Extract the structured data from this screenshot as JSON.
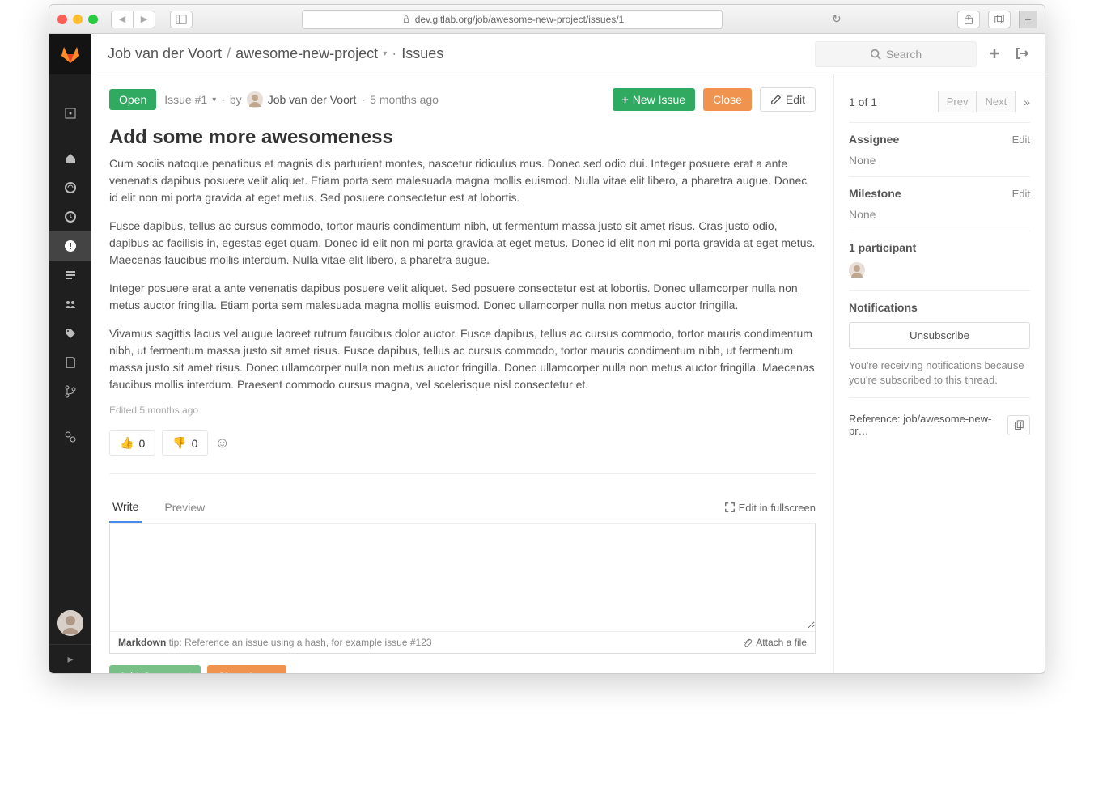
{
  "browser": {
    "url": "dev.gitlab.org/job/awesome-new-project/issues/1"
  },
  "breadcrumb": {
    "owner": "Job van der Voort",
    "project": "awesome-new-project",
    "section": "Issues"
  },
  "search": {
    "placeholder": "Search"
  },
  "issue": {
    "state": "Open",
    "ref": "Issue #1",
    "by": "by",
    "author": "Job van der Voort",
    "time": "5 months ago",
    "title": "Add some more awesomeness",
    "paragraphs": {
      "p1": "Cum sociis natoque penatibus et magnis dis parturient montes, nascetur ridiculus mus. Donec sed odio dui. Integer posuere erat a ante venenatis dapibus posuere velit aliquet. Etiam porta sem malesuada magna mollis euismod. Nulla vitae elit libero, a pharetra augue. Donec id elit non mi porta gravida at eget metus. Sed posuere consectetur est at lobortis.",
      "p2": "Fusce dapibus, tellus ac cursus commodo, tortor mauris condimentum nibh, ut fermentum massa justo sit amet risus. Cras justo odio, dapibus ac facilisis in, egestas eget quam. Donec id elit non mi porta gravida at eget metus. Donec id elit non mi porta gravida at eget metus. Maecenas faucibus mollis interdum. Nulla vitae elit libero, a pharetra augue.",
      "p3": "Integer posuere erat a ante venenatis dapibus posuere velit aliquet. Sed posuere consectetur est at lobortis. Donec ullamcorper nulla non metus auctor fringilla. Etiam porta sem malesuada magna mollis euismod. Donec ullamcorper nulla non metus auctor fringilla.",
      "p4": "Vivamus sagittis lacus vel augue laoreet rutrum faucibus dolor auctor. Fusce dapibus, tellus ac cursus commodo, tortor mauris condimentum nibh, ut fermentum massa justo sit amet risus. Fusce dapibus, tellus ac cursus commodo, tortor mauris condimentum nibh, ut fermentum massa justo sit amet risus. Donec ullamcorper nulla non metus auctor fringilla. Donec ullamcorper nulla non metus auctor fringilla. Maecenas faucibus mollis interdum. Praesent commodo cursus magna, vel scelerisque nisl consectetur et."
    },
    "edited": "Edited 5 months ago"
  },
  "buttons": {
    "new_issue": "New Issue",
    "close": "Close",
    "edit": "Edit",
    "add_comment": "Add Comment",
    "close_issue": "Close Issue"
  },
  "reactions": {
    "up": "0",
    "down": "0"
  },
  "comment": {
    "write_tab": "Write",
    "preview_tab": "Preview",
    "fullscreen": "Edit in fullscreen",
    "md_label": "Markdown",
    "md_tip": " tip: Reference an issue using a hash, for example issue #123",
    "attach": "Attach a file"
  },
  "sidebar": {
    "counter": "1 of 1",
    "prev": "Prev",
    "next": "Next",
    "assignee_label": "Assignee",
    "assignee_value": "None",
    "milestone_label": "Milestone",
    "milestone_value": "None",
    "edit": "Edit",
    "participants": "1 participant",
    "notifications": "Notifications",
    "unsubscribe": "Unsubscribe",
    "notif_note": "You're receiving notifications because you're subscribed to this thread.",
    "reference_label": "Reference: ",
    "reference_value": "job/awesome-new-pr…"
  }
}
